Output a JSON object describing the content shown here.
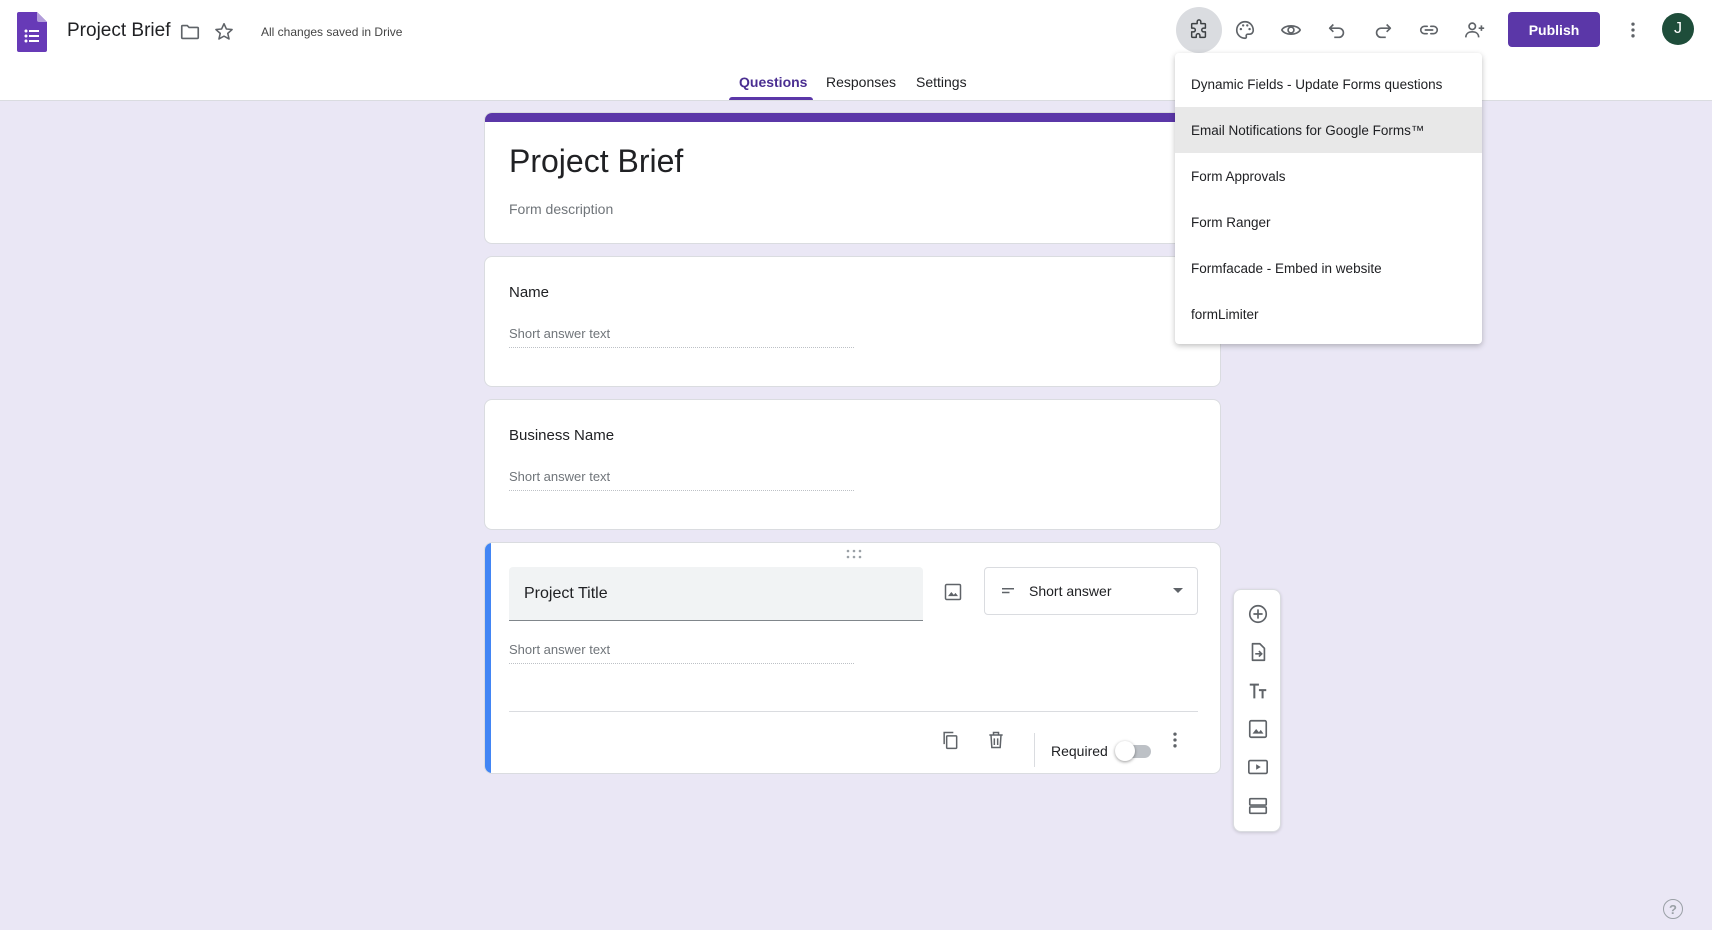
{
  "app": {
    "doc_title": "Project Brief",
    "save_status": "All changes saved in Drive",
    "publish_label": "Publish",
    "avatar_letter": "J",
    "accent_color": "#5b37a8"
  },
  "tabs": [
    {
      "label": "Questions",
      "active": true
    },
    {
      "label": "Responses",
      "active": false
    },
    {
      "label": "Settings",
      "active": false
    }
  ],
  "form": {
    "title": "Project Brief",
    "description": "Form description"
  },
  "questions": [
    {
      "label": "Name",
      "answer_placeholder": "Short answer text"
    },
    {
      "label": "Business Name",
      "answer_placeholder": "Short answer text"
    },
    {
      "label": "Project Title",
      "answer_placeholder": "Short answer text",
      "type": "Short answer",
      "required_label": "Required",
      "required": false
    }
  ],
  "addons_menu": {
    "items": [
      {
        "label": "Dynamic Fields - Update Forms questions",
        "highlighted": false
      },
      {
        "label": "Email Notifications for Google Forms™",
        "highlighted": true
      },
      {
        "label": "Form Approvals",
        "highlighted": false
      },
      {
        "label": "Form Ranger",
        "highlighted": false
      },
      {
        "label": "Formfacade - Embed in website",
        "highlighted": false
      },
      {
        "label": "formLimiter",
        "highlighted": false
      }
    ]
  },
  "icons": {
    "toolbar": [
      "addons-icon",
      "palette-icon",
      "preview-icon",
      "undo-icon",
      "redo-icon",
      "link-icon",
      "add-collaborator-icon",
      "more-vert-icon"
    ],
    "side_toolbar": [
      "add-question-icon",
      "import-questions-icon",
      "add-title-icon",
      "add-image-icon",
      "add-video-icon",
      "add-section-icon"
    ]
  },
  "help_symbol": "?"
}
